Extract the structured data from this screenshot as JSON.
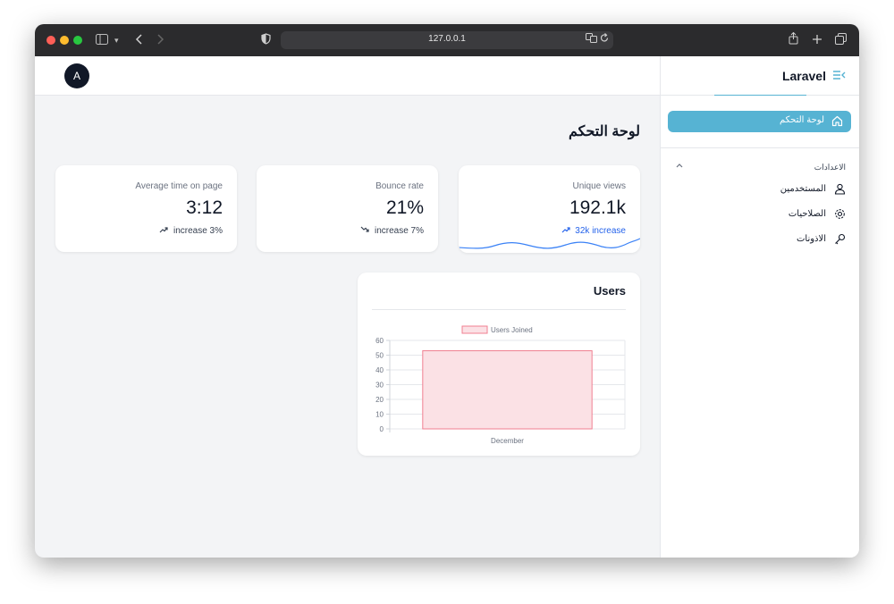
{
  "browser": {
    "url": "127.0.0.1",
    "icons": {
      "sidebar_toggle": "sidebar-icon",
      "chevron_down": "chevron-down-icon",
      "back": "back-icon",
      "forward": "forward-icon",
      "shield": "shield-icon",
      "translate": "translate-icon",
      "reload": "reload-icon",
      "share": "share-icon",
      "new_tab": "plus-icon",
      "tabs_overview": "tabs-icon"
    }
  },
  "header": {
    "avatar_initial": "A"
  },
  "sidebar": {
    "brand": "Laravel",
    "active_item": {
      "label": "لوحة التحكم",
      "icon": "home-icon"
    },
    "section": {
      "label": "الاعدادات",
      "expanded": true
    },
    "items": [
      {
        "label": "المستخدمين",
        "icon": "users-icon"
      },
      {
        "label": "الصلاحيات",
        "icon": "gear-icon"
      },
      {
        "label": "الاذونات",
        "icon": "key-icon"
      }
    ],
    "accent_color": "#56b3d3"
  },
  "main": {
    "title": "لوحة التحكم",
    "stats": [
      {
        "label": "Unique views",
        "value": "192.1k",
        "trend": "32k increase",
        "direction": "up",
        "color": "#2563eb"
      },
      {
        "label": "Bounce rate",
        "value": "21%",
        "trend": "increase 7%",
        "direction": "down",
        "color": "#374151"
      },
      {
        "label": "Average time on page",
        "value": "3:12",
        "trend": "increase 3%",
        "direction": "up",
        "color": "#374151"
      }
    ],
    "users_card": {
      "title": "Users"
    }
  },
  "chart_data": {
    "type": "bar",
    "title": "",
    "categories": [
      "December"
    ],
    "series": [
      {
        "name": "Users Joined",
        "values": [
          53
        ]
      }
    ],
    "ylim": [
      0,
      60
    ],
    "yticks": [
      0,
      10,
      20,
      30,
      40,
      50,
      60
    ],
    "grid": true,
    "legend": "top",
    "colors": {
      "fill": "#fbe1e5",
      "stroke": "#f07f91"
    }
  }
}
